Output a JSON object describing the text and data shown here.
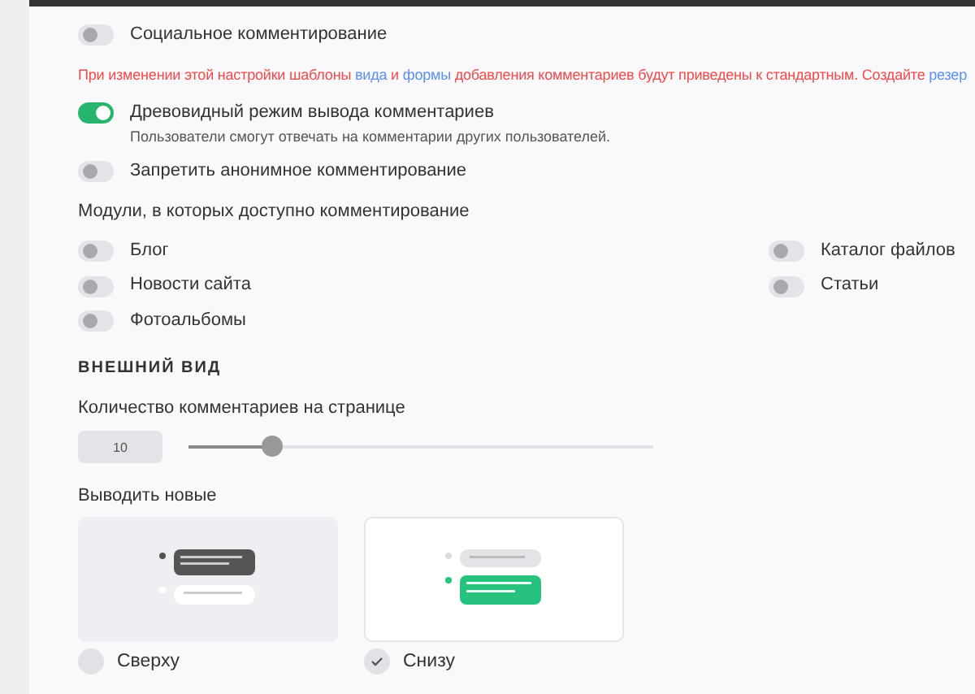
{
  "settings": [
    {
      "label": "Социальное комментирование",
      "on": false
    },
    {
      "kind": "warning",
      "parts": [
        {
          "kind": "text",
          "text": "При изменении этой настройки шаблоны "
        },
        {
          "kind": "link",
          "text": "вида"
        },
        {
          "kind": "text",
          "text": " и "
        },
        {
          "kind": "link",
          "text": "формы"
        },
        {
          "kind": "text",
          "text": " добавления комментариев будут приведены к стандартным. Создайте "
        },
        {
          "kind": "link",
          "text": "резер"
        }
      ]
    },
    {
      "label": "Древовидный режим вывода комментариев",
      "on": true,
      "hint": "Пользователи смогут отвечать на комментарии других пользователей."
    },
    {
      "label": "Запретить анонимное комментирование",
      "on": false
    }
  ],
  "modules": {
    "title": "Модули, в которых доступно комментирование",
    "columns": [
      [
        {
          "label": "Блог",
          "on": false
        },
        {
          "label": "Новости сайта",
          "on": false
        },
        {
          "label": "Фотоальбомы",
          "on": false
        }
      ],
      [
        {
          "label": "Каталог файлов",
          "on": false
        },
        {
          "label": "Статьи",
          "on": false
        }
      ]
    ]
  },
  "appearance": {
    "heading": "ВНЕШНИЙ ВИД",
    "per_page": {
      "label": "Количество комментариев на странице",
      "value": "10",
      "level": 0.18
    },
    "order": {
      "label": "Выводить новые",
      "options": [
        {
          "label": "Сверху",
          "selected": false
        },
        {
          "label": "Снизу",
          "selected": true
        }
      ]
    }
  }
}
